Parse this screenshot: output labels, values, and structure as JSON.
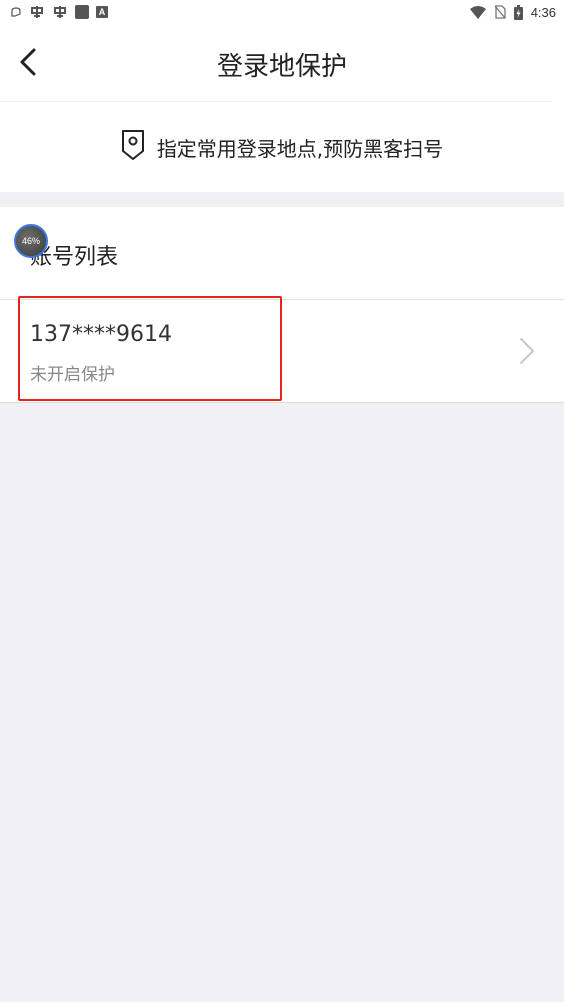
{
  "status_bar": {
    "time": "4:36",
    "icons": [
      "notification-icon",
      "app-icon",
      "app-icon",
      "square-icon",
      "a-icon",
      "wifi-icon",
      "no-sim-icon",
      "battery-icon"
    ],
    "a_label": "A"
  },
  "header": {
    "title": "登录地保护",
    "back_icon": "back-chevron-icon"
  },
  "hint": {
    "text": "指定常用登录地点,预防黑客扫号",
    "icon": "location-tag-icon"
  },
  "section": {
    "title": "账号列表",
    "accounts": [
      {
        "number": "137****9614",
        "status": "未开启保护"
      }
    ]
  },
  "floating_widget": {
    "label": "46%",
    "progress": 46
  },
  "colors": {
    "background": "#efeff4",
    "highlight": "#e5251d",
    "widget_ring": "#3a7be8"
  }
}
